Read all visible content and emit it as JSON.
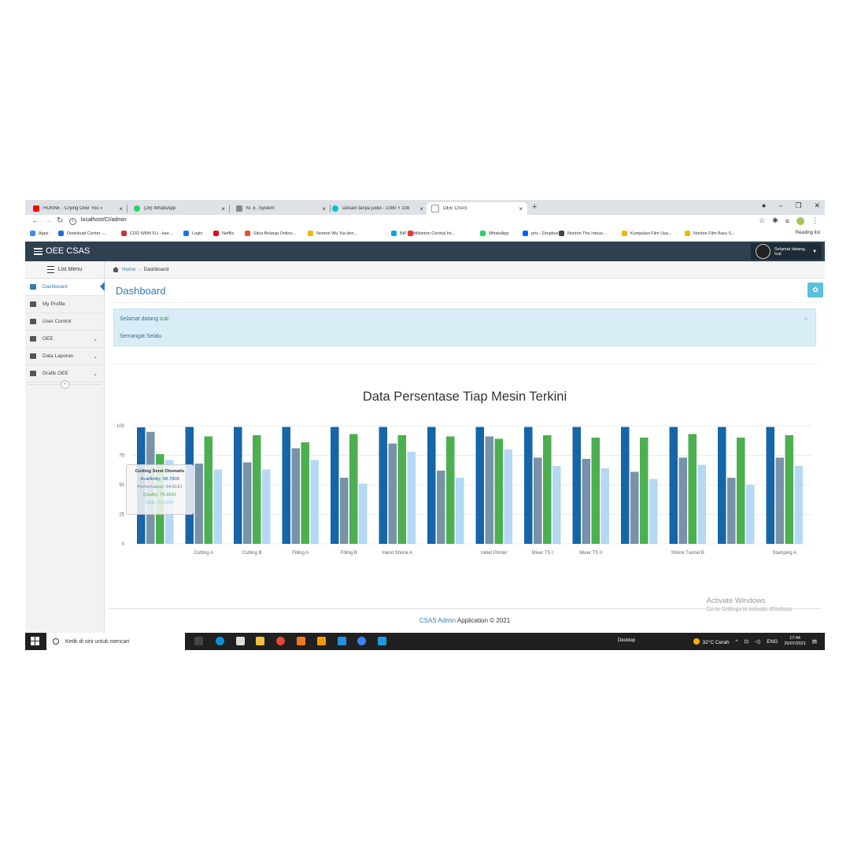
{
  "browser": {
    "tabs": [
      {
        "label": "HONNE - Crying Over You ◐",
        "icon": "youtube-icon",
        "color": "#ff0000"
      },
      {
        "label": "(26) WhatsApp",
        "icon": "whatsapp-icon",
        "color": "#25d366"
      },
      {
        "label": "M. E. System",
        "icon": "anchor-icon",
        "color": "#666666"
      },
      {
        "label": "Desain tanpa judul - 1080 × 108",
        "icon": "canva-icon",
        "color": "#00c4cc"
      },
      {
        "label": "OEE CSAS",
        "icon": "page-icon",
        "color": "#999999"
      }
    ],
    "new_tab": "+",
    "url": "localhost/CI/admin",
    "bookmarks": [
      {
        "label": "Apps",
        "color": "#4285f4"
      },
      {
        "label": "Download Center -...",
        "color": "#1e6fd9"
      },
      {
        "label": "COD WWII FU - kee...",
        "color": "#d32f2f"
      },
      {
        "label": "Login",
        "color": "#1a73e8"
      },
      {
        "label": "Netflix",
        "color": "#e50914"
      },
      {
        "label": "Situs Belanja Online...",
        "color": "#ee4d2d"
      },
      {
        "label": "Nonton Wu Xia den...",
        "color": "#f4b400"
      },
      {
        "label": "BiP Web",
        "color": "#00a3e0"
      },
      {
        "label": "Nonton Central Int...",
        "color": "#e53935"
      },
      {
        "label": "WhatsApp",
        "color": "#25d366"
      },
      {
        "label": "priv - Dropbox",
        "color": "#0061ff"
      },
      {
        "label": "Nonton The Intouc...",
        "color": "#444444"
      },
      {
        "label": "Kumpulan Film Usa...",
        "color": "#f4b400"
      },
      {
        "label": "Nonton Film Baru S...",
        "color": "#f4b400"
      }
    ],
    "reading_list": "Reading list"
  },
  "app": {
    "brand": "OEE CSAS",
    "user_greeting": "Selamat datang,",
    "user_name": "Ical",
    "accent": "#337ab7",
    "navbar_color": "#2f4050"
  },
  "sidebar": {
    "header": "List Menu",
    "items": [
      {
        "label": "Dashboard",
        "icon": "dashboard-icon",
        "active": true,
        "expandable": false
      },
      {
        "label": "My Profile",
        "icon": "user-icon",
        "active": false,
        "expandable": false
      },
      {
        "label": "User Control",
        "icon": "gears-icon",
        "active": false,
        "expandable": false
      },
      {
        "label": "OEE",
        "icon": "table-icon",
        "active": false,
        "expandable": true
      },
      {
        "label": "Data Laporan",
        "icon": "book-icon",
        "active": false,
        "expandable": true
      },
      {
        "label": "Grafik OEE",
        "icon": "bar-chart-icon",
        "active": false,
        "expandable": true
      }
    ],
    "collapse_symbol": "«"
  },
  "breadcrumb": {
    "home": "Home",
    "current": "Dashboard"
  },
  "page": {
    "title": "Dashboard",
    "alert_prefix": "Selamat datang",
    "alert_name": "Ical",
    "alert_suffix": ".",
    "alert_line2": "Semangat Selalu",
    "alert_close": "×"
  },
  "chart_data": {
    "type": "bar",
    "title": "Data Persentase Tiap Mesin Terkini",
    "ylim": [
      0,
      100
    ],
    "yticks": [
      0,
      25,
      50,
      75,
      100
    ],
    "grid": true,
    "categories": [
      "",
      "Cutting A",
      "Cutting B",
      "Filling A",
      "Filling B",
      "Hand Shrink A",
      "",
      "Inklet Printer",
      "Mixer TS I",
      "Mixer TS II",
      "",
      "Shrink Tunnel B",
      "",
      "Stamping A"
    ],
    "series": [
      {
        "name": "Availibility",
        "color": "#1565a8",
        "values": [
          98.7,
          99,
          99,
          99,
          99,
          99,
          99,
          99,
          99,
          99,
          99,
          99,
          99,
          99
        ]
      },
      {
        "name": "Performance",
        "color": "#7892a8",
        "values": [
          94.8,
          68,
          69,
          81,
          56,
          85,
          62,
          91,
          73,
          72,
          61,
          73,
          56,
          73
        ]
      },
      {
        "name": "Quality",
        "color": "#4caf50",
        "values": [
          75.95,
          91,
          92,
          86,
          93,
          92,
          91,
          89,
          92,
          90,
          90,
          93,
          90,
          92
        ]
      },
      {
        "name": "",
        "color": "#b3d9f5",
        "values": [
          71,
          63,
          63,
          71,
          51,
          78,
          56,
          80,
          66,
          64,
          55,
          67,
          50,
          66
        ]
      }
    ],
    "tooltip": {
      "title": "Cutting Semi Otomatis",
      "availability": "Availibility: 98.7808",
      "performance": "Performance: 94.8181",
      "quality": "Quality: 75.9542",
      "oee": "OEE: 71.0147"
    }
  },
  "watermark": {
    "line1": "Activate Windows",
    "line2": "Go to Settings to activate Windows."
  },
  "footer": {
    "brand": "CSAS Admin",
    "text": "Application © 2021"
  },
  "taskbar": {
    "search_placeholder": "Ketik di sini untuk mencari",
    "desktop": "Desktop",
    "weather": "32°C  Cerah",
    "lang": "ENG",
    "time": "17:44",
    "date": "25/07/2021"
  }
}
